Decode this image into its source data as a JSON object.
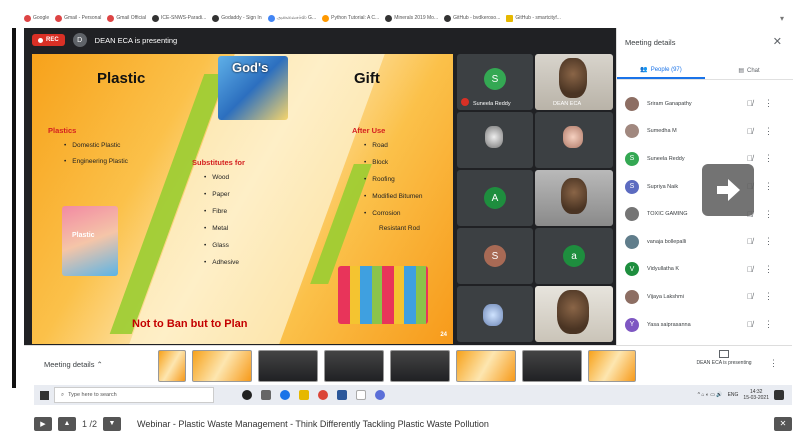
{
  "bookmarks": [
    {
      "label": "Google",
      "icon": "google-icon"
    },
    {
      "label": "Gmail - Personal",
      "icon": "gmail-icon"
    },
    {
      "label": "Gmail Official",
      "icon": "gmail-icon"
    },
    {
      "label": "ICE-SNWS-Paradi...",
      "icon": "globe-icon"
    },
    {
      "label": "Godaddy - Sign In",
      "icon": "globe-icon"
    },
    {
      "label": "அனலைசர்ஸ் G...",
      "icon": "google-icon"
    },
    {
      "label": "Python Tutorial: A C...",
      "icon": "python-icon"
    },
    {
      "label": "Minerals 2019 Mo...",
      "icon": "globe-icon"
    },
    {
      "label": "GitHub - bvdkeroso...",
      "icon": "github-icon"
    },
    {
      "label": "GitHub - smartcityf...",
      "icon": "bookmark-icon"
    }
  ],
  "meet": {
    "rec_label": "REC",
    "presenter_initial": "D",
    "presenter_text": "DEAN ECA is presenting",
    "slide": {
      "heading_left": "Plastic",
      "heading_center": "God's",
      "heading_right": "Gift",
      "plastics_title": "Plastics",
      "plastics_items": [
        "Domestic Plastic",
        "Engineering Plastic"
      ],
      "plastic_image_label": "Plastic",
      "substitutes_title": "Substitutes for",
      "substitutes_items": [
        "Wood",
        "Paper",
        "Fibre",
        "Metal",
        "Glass",
        "Adhesive"
      ],
      "after_use_title": "After Use",
      "after_use_items": [
        "Road",
        "Block",
        "Roofing",
        "Modified Bitumen",
        "Corrosion",
        "Resistant Rod"
      ],
      "footer": "Not to Ban but to Plan",
      "page_number": "24"
    },
    "tiles": [
      {
        "initial": "S",
        "name": "Suneela Reddy",
        "color": "#34a853"
      },
      {
        "name": "DEAN ECA"
      },
      {
        "initial": "A",
        "color": "#1e8e3e"
      },
      {
        "initial": "S",
        "color": "#a86a55"
      },
      {
        "initial": "a",
        "color": "#1e8e3e"
      }
    ]
  },
  "panel": {
    "title": "Meeting details",
    "tab_people": "People (97)",
    "tab_chat": "Chat",
    "people": [
      {
        "name": "Sriram Ganapathy",
        "initial": "",
        "color": "#8d6e63"
      },
      {
        "name": "Sumedha M",
        "initial": "",
        "color": "#a1887f"
      },
      {
        "name": "Suneela Reddy",
        "initial": "S",
        "color": "#34a853"
      },
      {
        "name": "Supriya Naik",
        "initial": "S",
        "color": "#5c6bc0"
      },
      {
        "name": "TOXIC GAMING",
        "initial": "",
        "color": "#757575"
      },
      {
        "name": "vanaja bollepalli",
        "initial": "",
        "color": "#607d8b"
      },
      {
        "name": "Vidyullatha K",
        "initial": "V",
        "color": "#1e8e3e"
      },
      {
        "name": "Vijaya Lakshmi",
        "initial": "",
        "color": "#8d6e63"
      },
      {
        "name": "Yasa saiprasanna",
        "initial": "Y",
        "color": "#7e57c2"
      }
    ]
  },
  "bottom": {
    "meeting_details": "Meeting details",
    "dean_box": "DEAN ECA is presenting"
  },
  "taskbar": {
    "search_placeholder": "Type here to search",
    "lang": "ENG",
    "time": "14:32",
    "date": "15-03-2021"
  },
  "pdfbar": {
    "page": "1 /2",
    "title": "Webinar - Plastic Waste Management - Think Differently Tackling Plastic Waste Pollution"
  }
}
